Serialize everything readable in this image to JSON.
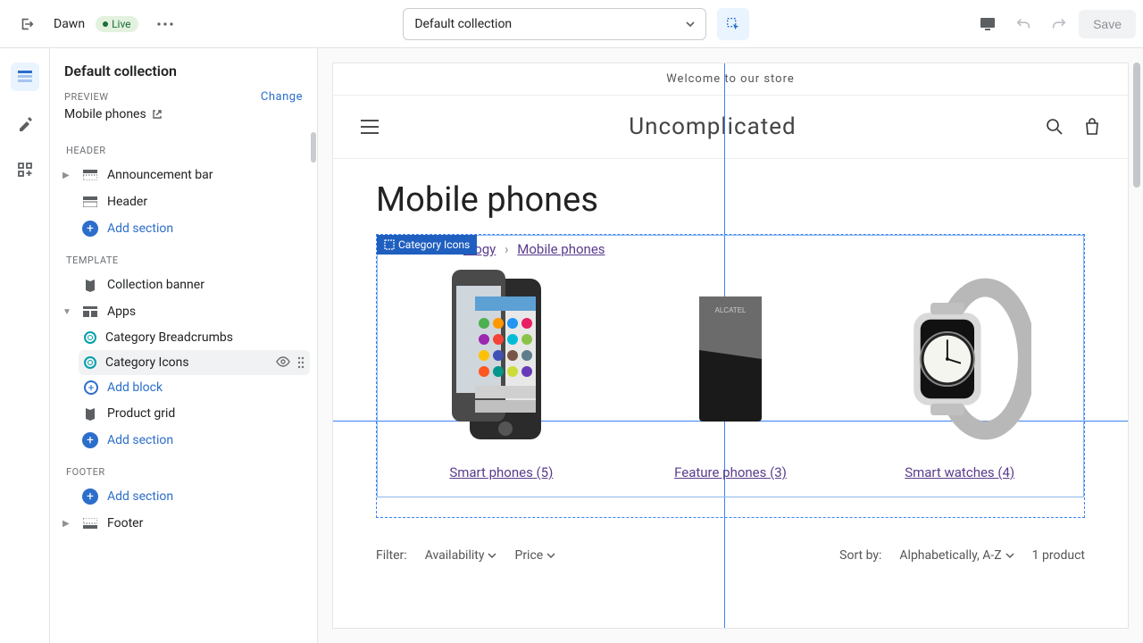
{
  "topbar": {
    "theme_name": "Dawn",
    "badge": "Live",
    "template_selector": "Default collection",
    "save_label": "Save"
  },
  "sidebar": {
    "title": "Default collection",
    "preview_label": "PREVIEW",
    "change_label": "Change",
    "preview_value": "Mobile phones",
    "groups": {
      "header": "HEADER",
      "template": "TEMPLATE",
      "footer": "FOOTER"
    },
    "sections": {
      "announcement_bar": "Announcement bar",
      "header": "Header",
      "collection_banner": "Collection banner",
      "apps": "Apps",
      "product_grid": "Product grid",
      "footer": "Footer"
    },
    "blocks": {
      "category_breadcrumbs": "Category Breadcrumbs",
      "category_icons": "Category Icons"
    },
    "add_section": "Add section",
    "add_block": "Add block"
  },
  "preview": {
    "announcement": "Welcome to our store",
    "store_name": "Uncomplicated",
    "collection_title": "Mobile phones",
    "section_tag": "Category Icons",
    "breadcrumbs": {
      "first_partial": "ology",
      "second": "Mobile phones"
    },
    "categories": [
      {
        "label": "Smart phones (5)"
      },
      {
        "label": "Feature phones (3)"
      },
      {
        "label": "Smart watches (4)"
      }
    ],
    "filter": {
      "label": "Filter:",
      "availability": "Availability",
      "price": "Price",
      "sort_label": "Sort by:",
      "sort_value": "Alphabetically, A-Z",
      "count": "1 product"
    }
  }
}
